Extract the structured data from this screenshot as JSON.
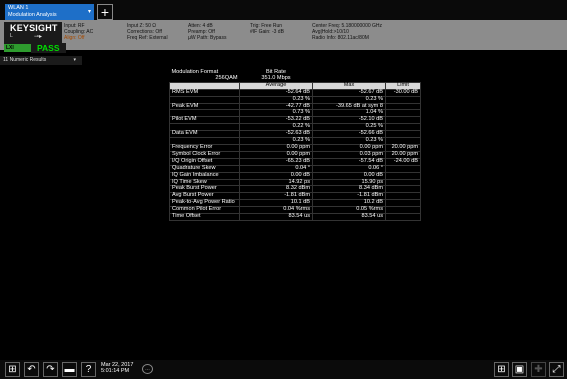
{
  "tab": {
    "line1": "WLAN 1",
    "line2": "Modulation Analysis"
  },
  "add_tab_label": "+",
  "brand": {
    "name": "KEYSIGHT",
    "sub_left": "L",
    "sub_right": "⊸▸",
    "lxi": "LXI",
    "status": "PASS"
  },
  "settings": {
    "col1": [
      "Input: RF",
      "Coupling: AC",
      "Align: Off"
    ],
    "col2": [
      "Input Z: 50 Ω",
      "Corrections: Off",
      "Freq Ref: External"
    ],
    "col3": [
      "Atten: 4 dB",
      "Preamp: Off",
      "µW Path: Bypass"
    ],
    "col4": [
      "Trig: Free Run",
      "#IF Gain: -3 dB"
    ],
    "col5": [
      "Center Freq: 5.180000000 GHz",
      "Avg|Hold:>10/10",
      "Radio Info: 802.11ac/80M"
    ]
  },
  "results_selector": {
    "label": "11 Numeric Results"
  },
  "table": {
    "modulation": {
      "format_label": "Modulation Format",
      "bitrate_label": "Bit Rate",
      "format_value": "256QAM",
      "bitrate_value": "351.0 Mbps"
    },
    "headers": {
      "average": "Average",
      "max": "Max",
      "limit": "Limit"
    },
    "rows": [
      {
        "label": "RMS EVM",
        "avg": "-52.64 dB",
        "max": "-52.67 dB",
        "limit": "-30.00 dB"
      },
      {
        "label": "",
        "avg": "0.23 %",
        "max": "0.23 %",
        "limit": ""
      },
      {
        "label": "Peak EVM",
        "avg": "-42.77 dB",
        "max": "-39.65 dB at sym 8",
        "limit": ""
      },
      {
        "label": "",
        "avg": "0.73 %",
        "max": "1.04 %",
        "limit": ""
      },
      {
        "label": "Pilot EVM",
        "avg": "-53.22 dB",
        "max": "-52.10 dB",
        "limit": ""
      },
      {
        "label": "",
        "avg": "0.22 %",
        "max": "0.25 %",
        "limit": ""
      },
      {
        "label": "Data EVM",
        "avg": "-52.63 dB",
        "max": "-52.66 dB",
        "limit": ""
      },
      {
        "label": "",
        "avg": "0.23 %",
        "max": "0.23 %",
        "limit": ""
      },
      {
        "label": "Frequency Error",
        "avg": "0.00 ppm",
        "max": "0.00 ppm",
        "limit": "20.00 ppm"
      },
      {
        "label": "Symbol Clock Error",
        "avg": "0.00 ppm",
        "max": "0.03 ppm",
        "limit": "20.00 ppm"
      },
      {
        "label": "I/Q Origin Offset",
        "avg": "-65.23 dB",
        "max": "-57.54 dB",
        "limit": "-24.00 dB"
      },
      {
        "label": "Quadrature Skew",
        "avg": "0.04 °",
        "max": "0.06 °",
        "limit": ""
      },
      {
        "label": "IQ Gain Imbalance",
        "avg": "0.00 dB",
        "max": "0.00 dB",
        "limit": ""
      },
      {
        "label": "IQ Time Skew",
        "avg": "14.92 ps",
        "max": "15.90 ps",
        "limit": ""
      },
      {
        "label": "Peak Burst Power",
        "avg": "8.32 dBm",
        "max": "8.34 dBm",
        "limit": ""
      },
      {
        "label": "Avg Burst Power",
        "avg": "-1.81 dBm",
        "max": "-1.81 dBm",
        "limit": ""
      },
      {
        "label": "Peak-to-Avg Power Ratio",
        "avg": "10.1 dB",
        "max": "10.2 dB",
        "limit": ""
      },
      {
        "label": "Common Pilot Error",
        "avg": "0.04 %rms",
        "max": "0.05 %rms",
        "limit": ""
      },
      {
        "label": "Time Offset",
        "avg": "83.54 us",
        "max": "83.54 us",
        "limit": ""
      }
    ]
  },
  "footer": {
    "date": "Mar 22, 2017",
    "time": "5:01:14 PM",
    "help": "?"
  },
  "colors": {
    "tab": "#1e6fc8",
    "info_bar": "#8c8c8c",
    "pass": "#2e9b2e"
  }
}
